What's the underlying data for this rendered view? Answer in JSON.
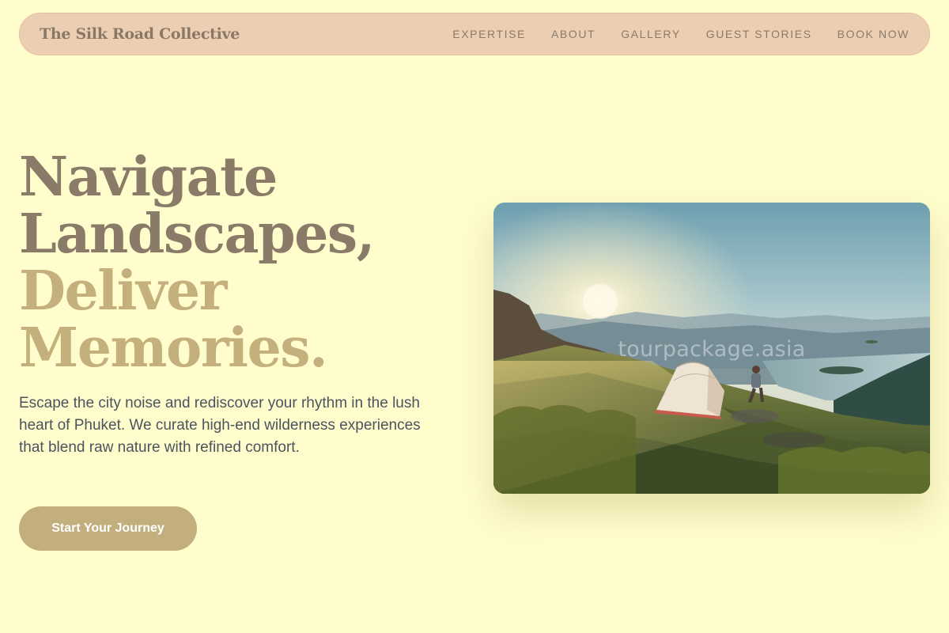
{
  "brand": {
    "name": "The Silk Road Collective"
  },
  "nav": {
    "items": [
      {
        "label": "EXPERTISE"
      },
      {
        "label": "ABOUT"
      },
      {
        "label": "GALLERY"
      },
      {
        "label": "GUEST STORIES"
      },
      {
        "label": "BOOK NOW"
      }
    ]
  },
  "hero": {
    "title_lines": [
      "Navigate",
      "Landscapes,",
      "Deliver",
      "Memories."
    ],
    "description": "Escape the city noise and rediscover your rhythm in the lush heart of Phuket. We curate high-end wilderness experiences that blend raw nature with refined comfort.",
    "cta_label": "Start Your Journey"
  },
  "image": {
    "watermark": "tourpackage.asia"
  },
  "colors": {
    "background": "#fffdcb",
    "navbar": "#eccfb3",
    "title_dark": "#8a7b69",
    "title_accent": "#c4b07c",
    "cta": "#c3ae7e"
  }
}
